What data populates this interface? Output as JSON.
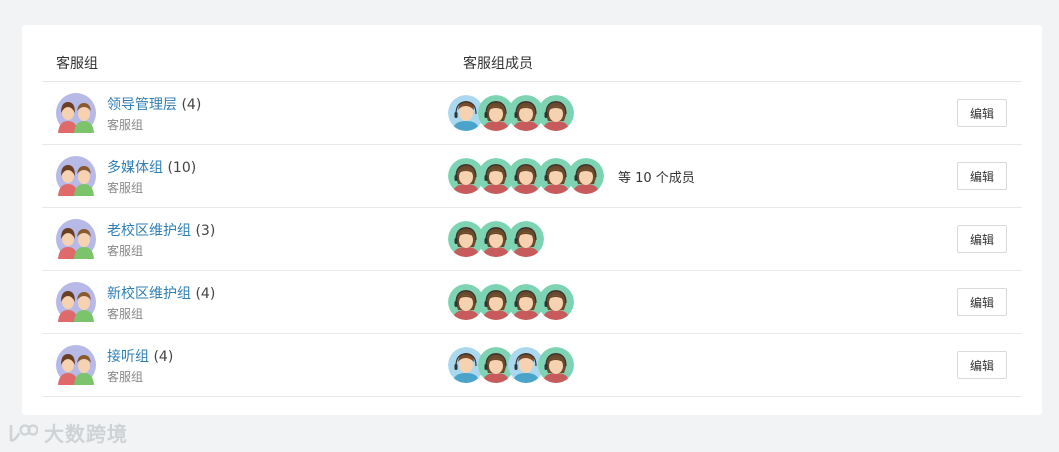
{
  "table": {
    "col_group": "客服组",
    "col_members": "客服组成员"
  },
  "groups": [
    {
      "name": "领导管理层",
      "count": "(4)",
      "type": "客服组",
      "members": [
        "male",
        "female",
        "female",
        "female"
      ],
      "more": "",
      "edit": "编辑"
    },
    {
      "name": "多媒体组",
      "count": "(10)",
      "type": "客服组",
      "members": [
        "female",
        "female",
        "female",
        "female",
        "female"
      ],
      "more": "等 10 个成员",
      "edit": "编辑"
    },
    {
      "name": "老校区维护组",
      "count": "(3)",
      "type": "客服组",
      "members": [
        "female",
        "female",
        "female"
      ],
      "more": "",
      "edit": "编辑"
    },
    {
      "name": "新校区维护组",
      "count": "(4)",
      "type": "客服组",
      "members": [
        "female",
        "female",
        "female",
        "female"
      ],
      "more": "",
      "edit": "编辑"
    },
    {
      "name": "接听组",
      "count": "(4)",
      "type": "客服组",
      "members": [
        "male",
        "female",
        "male",
        "female"
      ],
      "more": "",
      "edit": "编辑"
    }
  ],
  "watermark": "大数跨境",
  "colors": {
    "link": "#2f7fb6",
    "avatar_female_bg": "#7ed3b2",
    "avatar_male_bg": "#a9d8ef"
  }
}
